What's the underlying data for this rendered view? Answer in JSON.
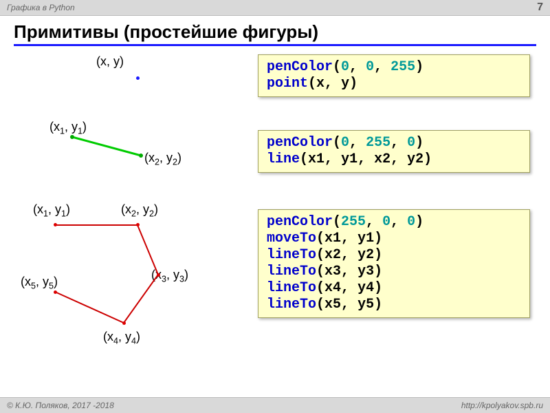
{
  "header": {
    "title": "Графика в Python",
    "page": "7"
  },
  "slide_title": "Примитивы (простейшие фигуры)",
  "labels": {
    "pt": "(x, y)",
    "l1": "(x",
    "l1s": "1",
    "l1m": ", y",
    "l1s2": "1",
    "l1e": ")",
    "l2": "(x",
    "l2s": "2",
    "l2m": ", y",
    "l2s2": "2",
    "l2e": ")",
    "p1": "(x",
    "p1s": "1",
    "p1m": ", y",
    "p1s2": "1",
    "p1e": ")",
    "p2": "(x",
    "p2s": "2",
    "p2m": ", y",
    "p2s2": "2",
    "p2e": ")",
    "p3": "(x",
    "p3s": "3",
    "p3m": ", y",
    "p3s2": "3",
    "p3e": ")",
    "p4": "(x",
    "p4s": "4",
    "p4m": ", y",
    "p4s2": "4",
    "p4e": ")",
    "p5": "(x",
    "p5s": "5",
    "p5m": ", y",
    "p5s2": "5",
    "p5e": ")"
  },
  "code1": {
    "fn1": "penColor",
    "a1": "0",
    "a2": "0",
    "a3": "255",
    "fn2": "point",
    "b1": "x",
    "b2": "y"
  },
  "code2": {
    "fn1": "penColor",
    "a1": "0",
    "a2": "255",
    "a3": "0",
    "fn2": "line",
    "b1": "x1",
    "b2": "y1",
    "b3": "x2",
    "b4": "y2"
  },
  "code3": {
    "fn1": "penColor",
    "a1": "255",
    "a2": "0",
    "a3": "0",
    "fn2": "moveTo",
    "b1": "x1",
    "b2": "y1",
    "fn3": "lineTo",
    "c1": "x2",
    "c2": "y2",
    "fn4": "lineTo",
    "d1": "x3",
    "d2": "y3",
    "fn5": "lineTo",
    "e1": "x4",
    "e2": "y4",
    "fn6": "lineTo",
    "f1": "x5",
    "f2": "y5"
  },
  "footer": {
    "left": "© К.Ю. Поляков, 2017 -2018",
    "right": "http://kpolyakov.spb.ru"
  }
}
